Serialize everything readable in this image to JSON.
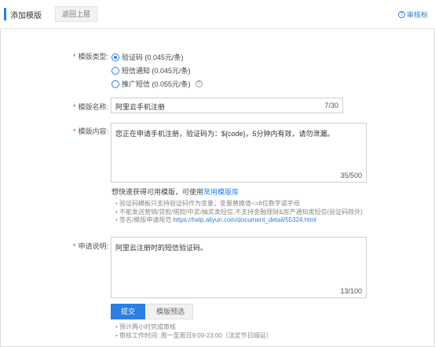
{
  "header": {
    "title": "添加模版",
    "back_button": "返回上层",
    "spec_link": "审核标"
  },
  "form": {
    "type": {
      "label": "模版类型:",
      "options": [
        {
          "label": "验证码 (0.045元/条)",
          "checked": true
        },
        {
          "label": "短信通知 (0.045元/条)",
          "checked": false
        },
        {
          "label": "推广短信 (0.055元/条)",
          "checked": false
        }
      ]
    },
    "name": {
      "label": "模版名称:",
      "value": "阿里云手机注册",
      "count": "7/30"
    },
    "content": {
      "label": "模版内容:",
      "value": "您正在申请手机注册，验证码为：${code}，5分钟内有效，请勿泄漏。",
      "count": "35/500",
      "hint_prefix": "想快速获得可用模版，可使用",
      "hint_link": "常用模版库",
      "notes": [
        "验证码模板只支持验证码作为变量；变量替换值<=6位数字或字母",
        "不能发送营销/贷款/借款/中奖/抽奖类短信,不支持金融理财&房产通知类短信(验证码除外)"
      ],
      "spec_prefix": "签名/模版申请规范 ",
      "spec_url": "https://help.aliyun.com/document_detail/55324.html"
    },
    "description": {
      "label": "申请说明:",
      "value": "阿里云注册时的短信验证码。",
      "count": "13/100"
    }
  },
  "actions": {
    "submit": "提交",
    "preview": "模版预选"
  },
  "footer_notes": [
    "预计两小时完成审核",
    "审核工作时间: 周一至周日9:00-23:00（法定节日顺延）"
  ],
  "colors": {
    "accent": "#2a7fe0",
    "required": "#e4393c"
  }
}
